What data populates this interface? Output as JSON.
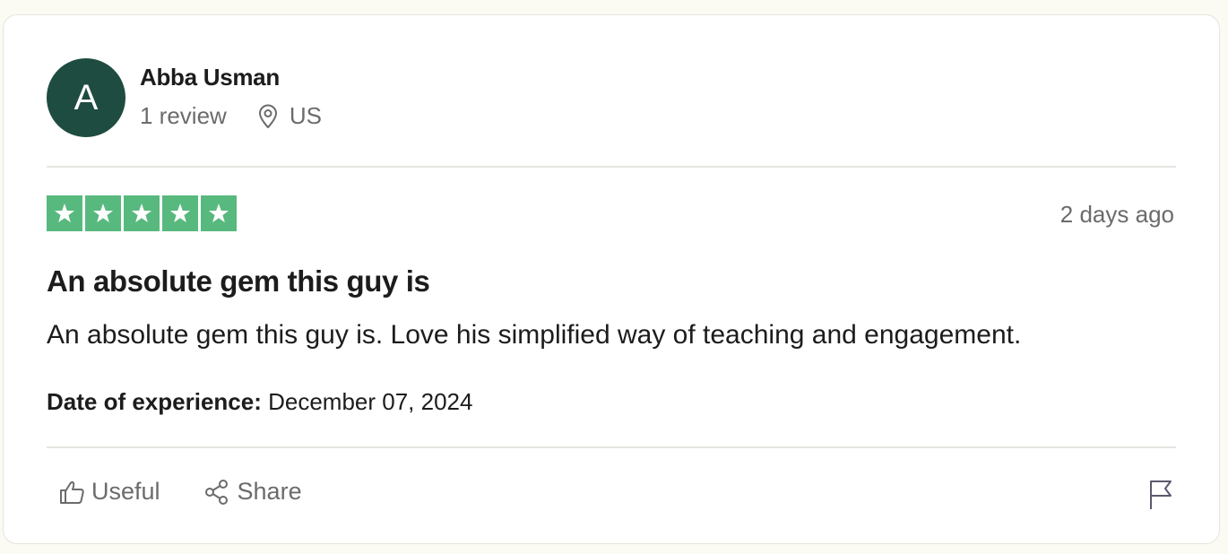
{
  "reviewer": {
    "initial": "A",
    "name": "Abba Usman",
    "review_count": "1 review",
    "location": "US",
    "avatar_color": "#1e4c40"
  },
  "review": {
    "rating": 5,
    "max_rating": 5,
    "star_color": "#58b97e",
    "relative_date": "2 days ago",
    "title": "An absolute gem this guy is",
    "body": "An absolute gem this guy is. Love his simplified way of teaching and engagement.",
    "experience_label": "Date of experience:",
    "experience_date": "December 07, 2024"
  },
  "actions": {
    "useful_label": "Useful",
    "share_label": "Share",
    "icons": [
      "thumbs-up-icon",
      "share-icon",
      "flag-icon"
    ]
  }
}
